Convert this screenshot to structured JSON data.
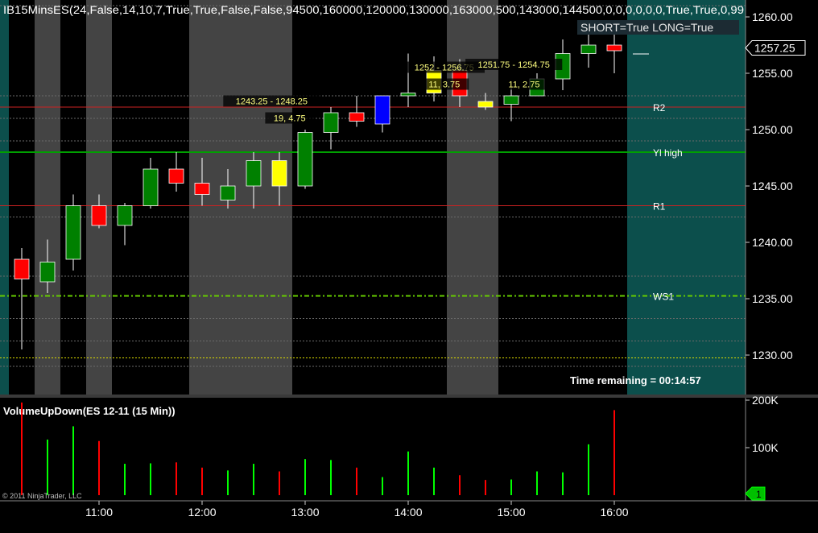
{
  "colors": {
    "up": "#008000",
    "down": "#ff0000",
    "yellow": "#ffff00",
    "blue": "#0000ff",
    "session_shade": "#444444",
    "future_area": "#0c4f4c",
    "vol_up": "#00ff00",
    "vol_down": "#ff0000"
  },
  "top_title": "IB15MinsES(24,False,14,10,7,True,True,False,False,94500,160000,120000,130000,163000,500,143000,144500,0,0,0,0,0,0,True,True,0,99",
  "status_label": "SHORT=True LONG=True",
  "time_remaining": "Time remaining = 00:14:57",
  "copyright": "© 2011 NinjaTrader, LLC",
  "chart_data": [
    {
      "type": "candlestick",
      "y_range": [
        1226.5,
        1261.5
      ],
      "y_ticks": [
        {
          "value": 1230,
          "label": "1230.00"
        },
        {
          "value": 1235,
          "label": "1235.00"
        },
        {
          "value": 1240,
          "label": "1240.00"
        },
        {
          "value": 1245,
          "label": "1245.00"
        },
        {
          "value": 1250,
          "label": "1250.00"
        },
        {
          "value": 1255,
          "label": "1255.00"
        },
        {
          "value": 1260,
          "label": "1260.00"
        }
      ],
      "last_price": {
        "value": 1257.25,
        "label": "1257.25"
      },
      "candles": [
        {
          "o": 1238.5,
          "h": 1239.5,
          "l": 1230.5,
          "c": 1236.75,
          "color": "down"
        },
        {
          "o": 1236.5,
          "h": 1240.25,
          "l": 1235.5,
          "c": 1238.25,
          "color": "up"
        },
        {
          "o": 1238.5,
          "h": 1244.25,
          "l": 1237.5,
          "c": 1243.25,
          "color": "up"
        },
        {
          "o": 1243.25,
          "h": 1244.25,
          "l": 1241.25,
          "c": 1241.5,
          "color": "down"
        },
        {
          "o": 1241.5,
          "h": 1243.5,
          "l": 1239.75,
          "c": 1243.25,
          "color": "up"
        },
        {
          "o": 1243.25,
          "h": 1247.5,
          "l": 1243.0,
          "c": 1246.5,
          "color": "up"
        },
        {
          "o": 1246.5,
          "h": 1248.0,
          "l": 1244.5,
          "c": 1245.25,
          "color": "down"
        },
        {
          "o": 1245.25,
          "h": 1247.5,
          "l": 1243.25,
          "c": 1244.25,
          "color": "down"
        },
        {
          "o": 1243.75,
          "h": 1246.5,
          "l": 1243.0,
          "c": 1245.0,
          "color": "up"
        },
        {
          "o": 1245.0,
          "h": 1248.0,
          "l": 1243.0,
          "c": 1247.25,
          "color": "up"
        },
        {
          "o": 1245.0,
          "h": 1248.0,
          "l": 1243.25,
          "c": 1247.25,
          "color": "yellow"
        },
        {
          "o": 1245.0,
          "h": 1250.0,
          "l": 1244.75,
          "c": 1249.75,
          "color": "up"
        },
        {
          "o": 1249.75,
          "h": 1252.0,
          "l": 1248.25,
          "c": 1251.5,
          "color": "up"
        },
        {
          "o": 1251.5,
          "h": 1253.0,
          "l": 1250.25,
          "c": 1250.75,
          "color": "down"
        },
        {
          "o": 1250.5,
          "h": 1253.0,
          "l": 1249.75,
          "c": 1253.0,
          "color": "blue"
        },
        {
          "o": 1253.0,
          "h": 1256.75,
          "l": 1252.0,
          "c": 1253.25,
          "color": "up"
        },
        {
          "o": 1253.25,
          "h": 1256.5,
          "l": 1252.5,
          "c": 1255.25,
          "color": "yellow"
        },
        {
          "o": 1255.25,
          "h": 1256.25,
          "l": 1252.0,
          "c": 1253.0,
          "color": "down"
        },
        {
          "o": 1252.0,
          "h": 1253.25,
          "l": 1251.75,
          "c": 1252.5,
          "color": "yellow"
        },
        {
          "o": 1252.25,
          "h": 1253.75,
          "l": 1250.75,
          "c": 1253.0,
          "color": "up"
        },
        {
          "o": 1253.0,
          "h": 1255.0,
          "l": 1253.0,
          "c": 1254.5,
          "color": "up"
        },
        {
          "o": 1254.5,
          "h": 1258.0,
          "l": 1253.5,
          "c": 1256.75,
          "color": "up"
        },
        {
          "o": 1256.75,
          "h": 1259.0,
          "l": 1255.5,
          "c": 1257.5,
          "color": "up"
        },
        {
          "o": 1257.5,
          "h": 1259.5,
          "l": 1255.0,
          "c": 1257.0,
          "color": "down"
        }
      ],
      "session_shading": [
        [
          1,
          1
        ],
        [
          3,
          3
        ],
        [
          7,
          10
        ],
        [
          17,
          18
        ]
      ],
      "levels": [
        {
          "label": "R2",
          "value": 1252.0,
          "color": "#cc2222",
          "style": "solid",
          "width": 1
        },
        {
          "label": "Yl high",
          "value": 1248.0,
          "color": "#00a000",
          "style": "solid",
          "width": 2
        },
        {
          "label": "R1",
          "value": 1243.25,
          "color": "#cc2222",
          "style": "solid",
          "width": 1
        },
        {
          "label": "WS1",
          "value": 1235.25,
          "color": "#66cc00",
          "style": "dashdot",
          "width": 2
        },
        {
          "label": "",
          "value": 1229.75,
          "color": "#dddd00",
          "style": "dotted",
          "width": 1
        }
      ],
      "dotted_lines": [
        1261.0,
        1253.0,
        1251.0,
        1249.0,
        1242.25,
        1237.0,
        1233.25,
        1231.25,
        1229.0
      ],
      "annotations": [
        {
          "text": "1243.25 - 1248.25",
          "bar": 9.7,
          "value": 1252.25
        },
        {
          "text": "19, 4.75",
          "bar": 10.4,
          "value": 1250.75
        },
        {
          "text": "1252 - 1256.75",
          "bar": 16.4,
          "value": 1255.25
        },
        {
          "text": "11, 3.75",
          "bar": 16.4,
          "value": 1253.75
        },
        {
          "text": "1251.75 - 1254.75",
          "bar": 19.1,
          "value": 1255.5
        },
        {
          "text": "11, 2.75",
          "bar": 19.5,
          "value": 1253.75
        }
      ]
    },
    {
      "type": "bar",
      "title": "VolumeUpDown(ES 12-11 (15 Min))",
      "y_range": [
        0,
        200000
      ],
      "y_ticks": [
        {
          "value": 100000,
          "label": "100K"
        },
        {
          "value": 200000,
          "label": "200K"
        }
      ],
      "last_label": "1",
      "volumes": [
        {
          "v": 195000,
          "d": "down"
        },
        {
          "v": 117000,
          "d": "up"
        },
        {
          "v": 145000,
          "d": "up"
        },
        {
          "v": 114000,
          "d": "down"
        },
        {
          "v": 66000,
          "d": "up"
        },
        {
          "v": 67000,
          "d": "up"
        },
        {
          "v": 69000,
          "d": "down"
        },
        {
          "v": 58000,
          "d": "down"
        },
        {
          "v": 52000,
          "d": "up"
        },
        {
          "v": 66000,
          "d": "up"
        },
        {
          "v": 50000,
          "d": "down"
        },
        {
          "v": 76000,
          "d": "up"
        },
        {
          "v": 74000,
          "d": "up"
        },
        {
          "v": 58000,
          "d": "down"
        },
        {
          "v": 38000,
          "d": "up"
        },
        {
          "v": 92000,
          "d": "up"
        },
        {
          "v": 58000,
          "d": "up"
        },
        {
          "v": 42000,
          "d": "down"
        },
        {
          "v": 32000,
          "d": "down"
        },
        {
          "v": 33000,
          "d": "up"
        },
        {
          "v": 50000,
          "d": "up"
        },
        {
          "v": 48000,
          "d": "up"
        },
        {
          "v": 107000,
          "d": "up"
        },
        {
          "v": 179000,
          "d": "down"
        }
      ]
    }
  ],
  "x_axis": {
    "labels": [
      {
        "text": "11:00",
        "bar": 3
      },
      {
        "text": "12:00",
        "bar": 7
      },
      {
        "text": "13:00",
        "bar": 11
      },
      {
        "text": "14:00",
        "bar": 15
      },
      {
        "text": "15:00",
        "bar": 19
      },
      {
        "text": "16:00",
        "bar": 23
      }
    ]
  }
}
